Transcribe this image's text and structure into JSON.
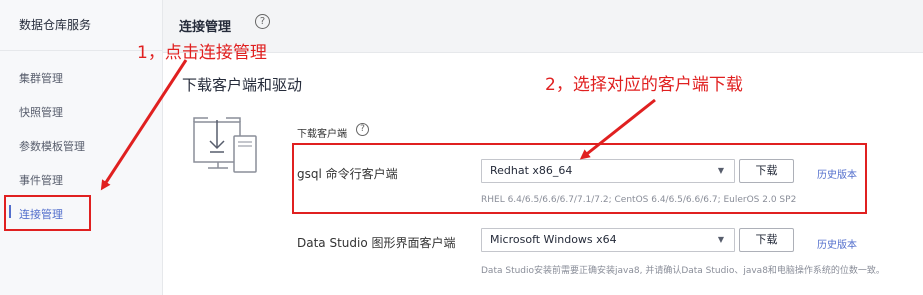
{
  "sidebar": {
    "title": "数据仓库服务",
    "items": [
      {
        "label": "集群管理"
      },
      {
        "label": "快照管理"
      },
      {
        "label": "参数模板管理"
      },
      {
        "label": "事件管理"
      },
      {
        "label": "连接管理"
      }
    ]
  },
  "header": {
    "title": "连接管理",
    "help_icon": "?"
  },
  "section": {
    "title": "下载客户端和驱动"
  },
  "download": {
    "label": "下载客户端",
    "help_icon": "?",
    "clients": [
      {
        "name": "gsql 命令行客户端",
        "selected": "Redhat x86_64",
        "button": "下载",
        "link": "历史版本",
        "hint": "RHEL 6.4/6.5/6.6/6.7/7.1/7.2; CentOS 6.4/6.5/6.6/6.7; EulerOS 2.0 SP2"
      },
      {
        "name": "Data Studio 图形界面客户端",
        "selected": "Microsoft Windows x64",
        "button": "下载",
        "link": "历史版本",
        "hint": "Data Studio安装前需要正确安装java8, 并请确认Data Studio、java8和电脑操作系统的位数一致。"
      }
    ]
  },
  "annotations": {
    "step1": "1，点击连接管理",
    "step2": "2，选择对应的客户端下载",
    "color": "#e02020"
  },
  "colors": {
    "accent": "#526ecc",
    "annotation": "#e02020"
  }
}
